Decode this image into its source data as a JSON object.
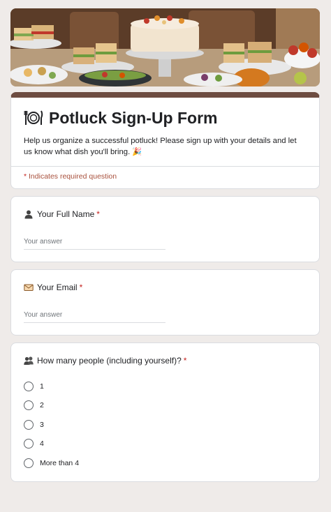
{
  "banner": {
    "image": "potluck-food-table-photo"
  },
  "form": {
    "title": "Potluck Sign-Up Form",
    "title_icon": "plate-fork-knife-icon",
    "description": "Help us organize a successful potluck! Please sign up with your details and let us know what dish you'll bring. 🎉",
    "required_note": "Indicates required question",
    "required_marker": "*"
  },
  "questions": {
    "name": {
      "label": "Your Full Name",
      "icon": "person-icon",
      "placeholder": "Your answer"
    },
    "email": {
      "label": "Your Email",
      "icon": "envelope-icon",
      "placeholder": "Your answer"
    },
    "people": {
      "label": "How many people (including yourself)?",
      "icon": "people-group-icon",
      "options": [
        "1",
        "2",
        "3",
        "4",
        "More than 4"
      ]
    }
  },
  "colors": {
    "accent": "#6d4c41",
    "required": "#c5221f",
    "background": "#efebe9"
  }
}
